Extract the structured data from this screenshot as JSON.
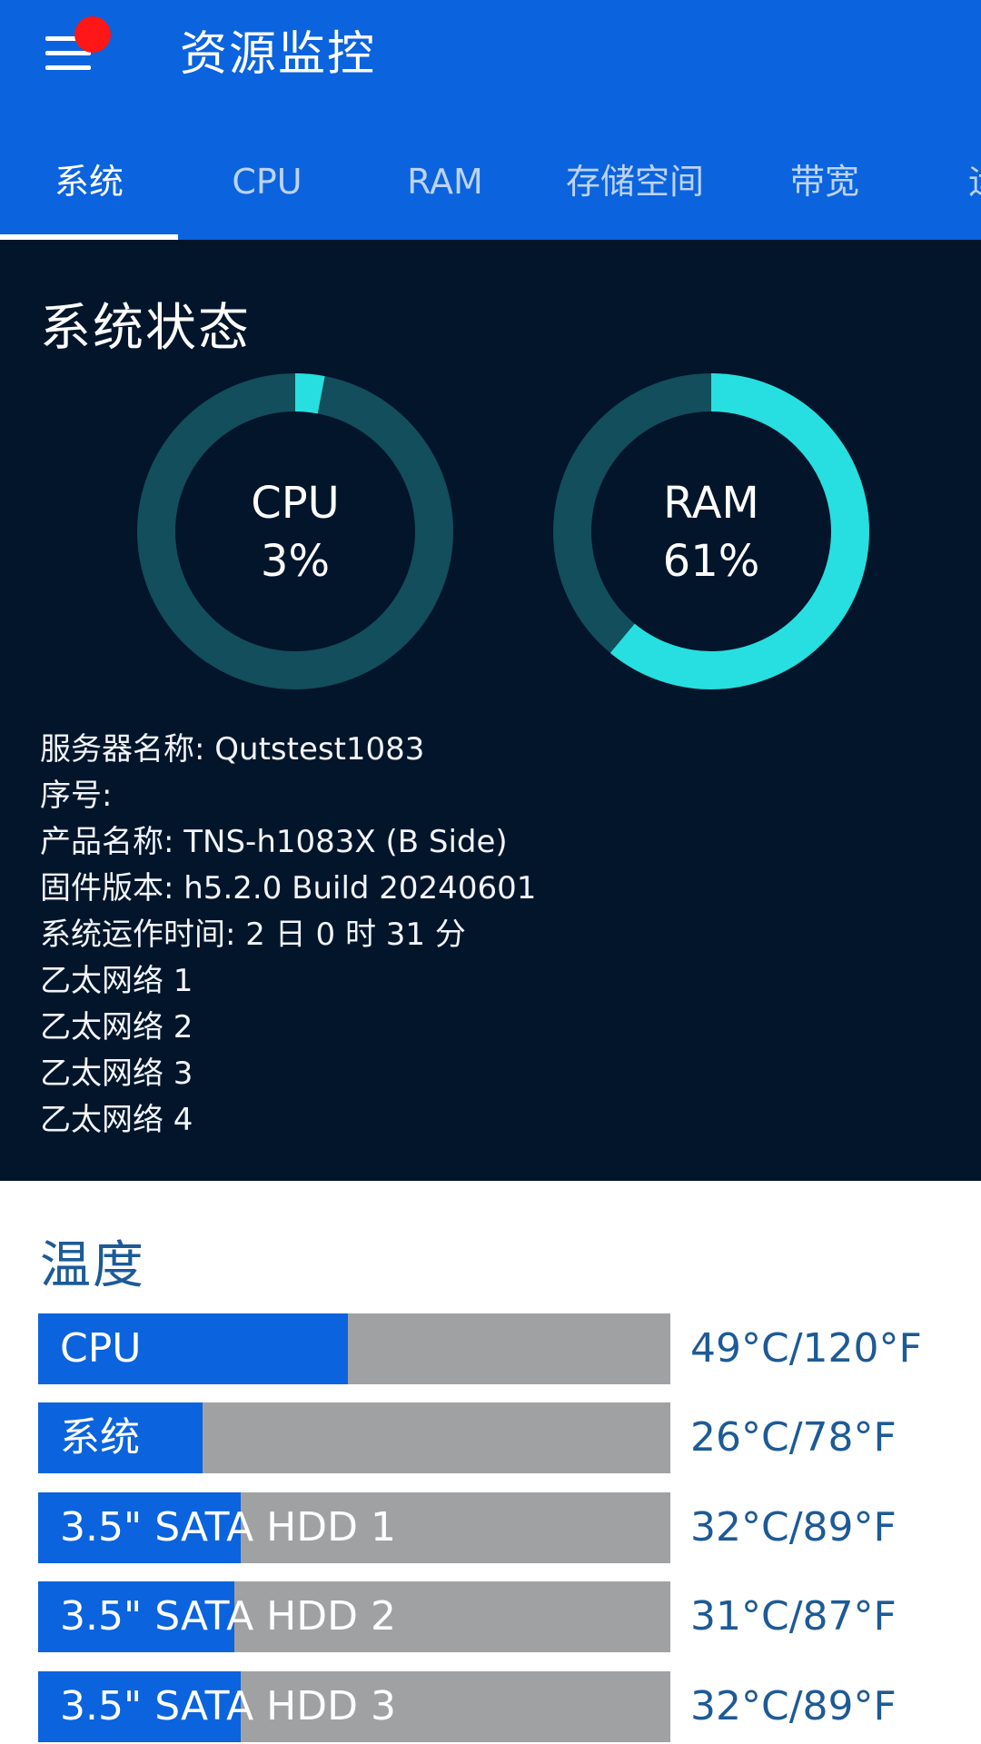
{
  "appbar": {
    "title": "资源监控",
    "has_notification": true
  },
  "tabs": [
    {
      "label": "系统",
      "active": true
    },
    {
      "label": "CPU"
    },
    {
      "label": "RAM"
    },
    {
      "label": "存储空间"
    },
    {
      "label": "带宽"
    },
    {
      "label": "运"
    }
  ],
  "system": {
    "title": "系统状态",
    "cpu_gauge": {
      "label": "CPU",
      "value_text": "3%",
      "percent": 3
    },
    "ram_gauge": {
      "label": "RAM",
      "value_text": "61%",
      "percent": 61
    },
    "info": {
      "server_name": "服务器名称: Qutstest1083",
      "serial": "序号:",
      "product": "产品名称:  TNS-h1083X (B Side)",
      "firmware": "固件版本: h5.2.0 Build 20240601",
      "uptime": "系统运作时间: 2 日 0 时 31 分",
      "ethernet": [
        "乙太网络 1",
        "乙太网络 2",
        "乙太网络 3",
        "乙太网络 4"
      ]
    }
  },
  "temperature": {
    "title": "温度",
    "rows": [
      {
        "label": "CPU",
        "value": "49°C/120°F",
        "fill_fraction": 0.49
      },
      {
        "label": "系统",
        "value": "26°C/78°F",
        "fill_fraction": 0.26
      },
      {
        "label": "3.5\" SATA HDD 1",
        "value": "32°C/89°F",
        "fill_fraction": 0.32
      },
      {
        "label": "3.5\" SATA HDD 2",
        "value": "31°C/87°F",
        "fill_fraction": 0.31
      },
      {
        "label": "3.5\" SATA HDD 3",
        "value": "32°C/89°F",
        "fill_fraction": 0.32
      }
    ]
  },
  "colors": {
    "primary": "#0b63dd",
    "panel_bg": "#02152a",
    "gauge_track": "#124e5c",
    "gauge_fill": "#27dfe0",
    "temp_track": "#a0a1a3",
    "temp_text": "#1d5a96",
    "notification": "#ff1616"
  },
  "icons": {
    "menu": "hamburger-menu-icon"
  }
}
